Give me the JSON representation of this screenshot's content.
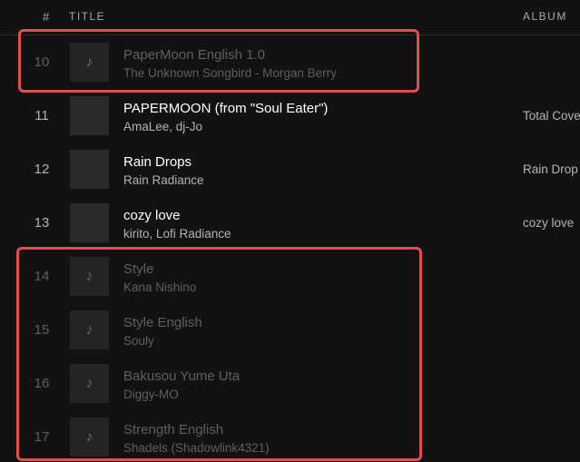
{
  "header": {
    "num": "#",
    "title": "TITLE",
    "album": "ALBUM"
  },
  "tracks": [
    {
      "index": "10",
      "title": "PaperMoon English 1.0",
      "artist": "The Unknown Songbird - Morgan Berry",
      "album": "",
      "disabled": true
    },
    {
      "index": "11",
      "title": "PAPERMOON (from \"Soul Eater\")",
      "artist": "AmaLee, dj-Jo",
      "album": "Total Cove",
      "disabled": false
    },
    {
      "index": "12",
      "title": "Rain Drops",
      "artist": "Rain Radiance",
      "album": "Rain Drop",
      "disabled": false
    },
    {
      "index": "13",
      "title": "cozy love",
      "artist": "kirito, Lofi Radiance",
      "album": "cozy love",
      "disabled": false
    },
    {
      "index": "14",
      "title": "Style",
      "artist": "Kana Nishino",
      "album": "",
      "disabled": true
    },
    {
      "index": "15",
      "title": "Style English",
      "artist": "Souly",
      "album": "",
      "disabled": true
    },
    {
      "index": "16",
      "title": "Bakusou Yume Uta",
      "artist": "Diggy-MO",
      "album": "",
      "disabled": true
    },
    {
      "index": "17",
      "title": "Strength English",
      "artist": "Shadels (Shadowlink4321)",
      "album": "",
      "disabled": true
    }
  ],
  "icons": {
    "placeholder": "music-note-icon",
    "note_glyph": "♪"
  },
  "colors": {
    "background": "#121212",
    "highlight": "#e0504d",
    "text": "#ffffff",
    "muted": "#b3b3b3",
    "disabled": "#5f5f5f"
  }
}
